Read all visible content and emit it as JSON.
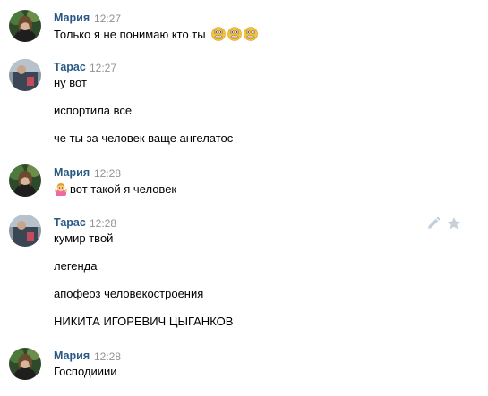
{
  "messages": [
    {
      "author": "Мария",
      "time": "12:27",
      "lines": [
        "Только я не понимаю кто ты"
      ],
      "emojis_after_text": [
        "wide-eyed-smiley-emoji",
        "wide-eyed-smiley-emoji",
        "wide-eyed-smiley-emoji"
      ]
    },
    {
      "author": "Тарас",
      "time": "12:27",
      "lines": [
        "ну вот",
        "испортила все",
        "че ты за человек ваще ангелатос"
      ]
    },
    {
      "author": "Мария",
      "time": "12:28",
      "emoji_before_text": "person-gesturing-emoji",
      "lines": [
        "вот такой я человек"
      ]
    },
    {
      "author": "Тарас",
      "time": "12:28",
      "lines": [
        "кумир твой",
        "легенда",
        "апофеоз человекостроения",
        "НИКИТА ИГОРЕВИЧ ЦЫГАНКОВ"
      ],
      "hover_actions": [
        "edit-pencil-icon",
        "favorite-star-icon"
      ]
    },
    {
      "author": "Мария",
      "time": "12:28",
      "lines": [
        "Господииии"
      ]
    }
  ],
  "colors": {
    "author": "#2a5885",
    "time": "#939393",
    "text": "#000000",
    "action_icon": "#c5d0db",
    "background": "#ffffff"
  }
}
